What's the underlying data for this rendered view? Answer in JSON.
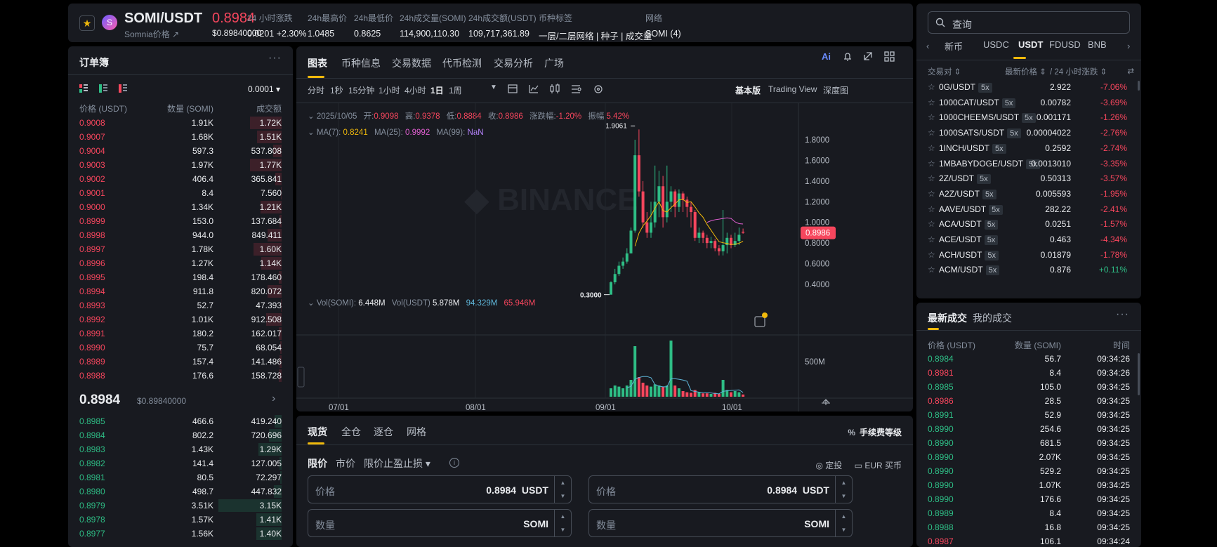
{
  "header": {
    "symbol": "SOMI/USDT",
    "subtitle": "Somnia价格 ↗",
    "last_price": "0.8984",
    "last_price_usd": "$0.89840000",
    "stats": [
      {
        "label": "24 小时涨跌",
        "value": "0.0201 +2.30%",
        "kind": "up"
      },
      {
        "label": "24h最高价",
        "value": "1.0485",
        "kind": "normal"
      },
      {
        "label": "24h最低价",
        "value": "0.8625",
        "kind": "normal"
      },
      {
        "label": "24h成交量(SOMI)",
        "value": "114,900,110.30",
        "kind": "normal"
      },
      {
        "label": "24h成交额(USDT)",
        "value": "109,717,361.89",
        "kind": "normal"
      },
      {
        "label": "币种标签",
        "value": "一层/二层网络 | 种子 | 成交量",
        "kind": "yellow"
      },
      {
        "label": "网络",
        "value": "SOMI (4)",
        "kind": "normal"
      }
    ]
  },
  "orderbook": {
    "title": "订单簿",
    "tick": "0.0001 ▾",
    "cols": [
      "价格 (USDT)",
      "数量 (SOMI)",
      "成交额"
    ],
    "asks": [
      [
        "0.9008",
        "1.91K",
        "1.72K",
        0.45
      ],
      [
        "0.9007",
        "1.68K",
        "1.51K",
        0.35
      ],
      [
        "0.9004",
        "597.3",
        "537.808",
        0.12
      ],
      [
        "0.9003",
        "1.97K",
        "1.77K",
        0.45
      ],
      [
        "0.9002",
        "406.4",
        "365.841",
        0.09
      ],
      [
        "0.9001",
        "8.4",
        "7.560",
        0.01
      ],
      [
        "0.9000",
        "1.34K",
        "1.21K",
        0.3
      ],
      [
        "0.8999",
        "153.0",
        "137.684",
        0.03
      ],
      [
        "0.8998",
        "944.0",
        "849.411",
        0.2
      ],
      [
        "0.8997",
        "1.78K",
        "1.60K",
        0.4
      ],
      [
        "0.8996",
        "1.27K",
        "1.14K",
        0.29
      ],
      [
        "0.8995",
        "198.4",
        "178.460",
        0.04
      ],
      [
        "0.8994",
        "911.8",
        "820.072",
        0.2
      ],
      [
        "0.8993",
        "52.7",
        "47.393",
        0.01
      ],
      [
        "0.8992",
        "1.01K",
        "912.508",
        0.22
      ],
      [
        "0.8991",
        "180.2",
        "162.017",
        0.04
      ],
      [
        "0.8990",
        "75.7",
        "68.054",
        0.02
      ],
      [
        "0.8989",
        "157.4",
        "141.486",
        0.03
      ],
      [
        "0.8988",
        "176.6",
        "158.728",
        0.04
      ]
    ],
    "mid_price": "0.8984",
    "mid_usd": "$0.89840000",
    "bids": [
      [
        "0.8985",
        "466.6",
        "419.240",
        0.1
      ],
      [
        "0.8984",
        "802.2",
        "720.696",
        0.18
      ],
      [
        "0.8983",
        "1.43K",
        "1.29K",
        0.33
      ],
      [
        "0.8982",
        "141.4",
        "127.005",
        0.03
      ],
      [
        "0.8981",
        "80.5",
        "72.297",
        0.02
      ],
      [
        "0.8980",
        "498.7",
        "447.832",
        0.11
      ],
      [
        "0.8979",
        "3.51K",
        "3.15K",
        0.9
      ],
      [
        "0.8978",
        "1.57K",
        "1.41K",
        0.36
      ],
      [
        "0.8977",
        "1.56K",
        "1.40K",
        0.36
      ]
    ]
  },
  "chart_panel": {
    "tabs": [
      "图表",
      "币种信息",
      "交易数据",
      "代币检测",
      "交易分析",
      "广场"
    ],
    "intervals": [
      "分时",
      "1秒",
      "15分钟",
      "1小时",
      "4小时",
      "1日",
      "1周"
    ],
    "active_interval": "1日",
    "views": [
      "基本版",
      "Trading View",
      "深度图"
    ],
    "ohlc_line": {
      "date": "2025/10/05",
      "open_l": "开:",
      "open": "0.9098",
      "high_l": "高:",
      "high": "0.9378",
      "low_l": "低:",
      "low": "0.8884",
      "close_l": "收:",
      "close": "0.8986",
      "chg_l": "涨跌幅:",
      "chg": "-1.20%",
      "amp_l": "振幅:",
      "amp": "5.42%"
    },
    "ma_line": {
      "ma7_l": "MA(7):",
      "ma7": "0.8241",
      "ma25_l": "MA(25):",
      "ma25": "0.9992",
      "ma99_l": "MA(99):",
      "ma99": "NaN"
    },
    "vol_line": {
      "vs_l": "Vol(SOMI):",
      "vs": "6.448M",
      "vu_l": "Vol(USDT)",
      "vu": "5.878M",
      "a": "94.329M",
      "b": "65.946M"
    },
    "watermark": "BINANCE",
    "price_tag": "0.8986",
    "high_label": "1.9061",
    "low_label": "0.3000"
  },
  "chart_data": {
    "type": "candlestick",
    "y_ticks": [
      "1.8000",
      "1.6000",
      "1.4000",
      "1.2000",
      "1.0000",
      "0.8000",
      "0.6000",
      "0.4000"
    ],
    "x_ticks": [
      "07/01",
      "08/01",
      "09/01",
      "10/01"
    ],
    "vol_tick": "500M",
    "candles": [
      [
        0.3,
        0.42,
        0.3,
        0.43
      ],
      [
        0.42,
        0.5,
        0.4,
        0.55
      ],
      [
        0.5,
        0.58,
        0.48,
        0.62
      ],
      [
        0.58,
        0.62,
        0.55,
        0.66
      ],
      [
        0.62,
        0.7,
        0.6,
        0.75
      ],
      [
        0.7,
        0.92,
        0.7,
        0.95
      ],
      [
        0.92,
        1.65,
        0.9,
        1.8
      ],
      [
        1.65,
        1.3,
        1.25,
        1.9
      ],
      [
        1.3,
        1.0,
        0.95,
        1.4
      ],
      [
        1.0,
        0.9,
        0.85,
        1.1
      ],
      [
        0.9,
        1.0,
        0.85,
        1.2
      ],
      [
        1.0,
        1.2,
        0.95,
        1.55
      ],
      [
        1.2,
        1.35,
        1.05,
        1.5
      ],
      [
        1.35,
        1.05,
        0.95,
        1.45
      ],
      [
        1.05,
        1.2,
        1.0,
        1.55
      ],
      [
        1.2,
        1.3,
        1.1,
        1.35
      ],
      [
        1.3,
        1.15,
        1.05,
        1.32
      ],
      [
        1.15,
        1.28,
        1.1,
        1.32
      ],
      [
        1.28,
        1.22,
        1.1,
        1.3
      ],
      [
        1.22,
        1.15,
        1.05,
        1.25
      ],
      [
        1.15,
        1.1,
        0.95,
        1.2
      ],
      [
        1.1,
        0.85,
        0.82,
        1.12
      ],
      [
        0.85,
        0.9,
        0.8,
        0.95
      ],
      [
        0.9,
        0.85,
        0.8,
        0.92
      ],
      [
        0.85,
        0.8,
        0.75,
        0.88
      ],
      [
        0.8,
        0.82,
        0.75,
        0.86
      ],
      [
        0.82,
        0.75,
        0.72,
        0.84
      ],
      [
        0.75,
        0.72,
        0.68,
        0.78
      ],
      [
        0.72,
        0.78,
        0.68,
        1.12
      ],
      [
        0.78,
        0.85,
        0.7,
        0.9
      ],
      [
        0.85,
        0.78,
        0.75,
        0.88
      ],
      [
        0.78,
        0.82,
        0.76,
        0.9
      ],
      [
        0.82,
        0.88,
        0.78,
        0.95
      ],
      [
        0.91,
        0.9,
        0.89,
        0.94
      ]
    ],
    "volumes": [
      0.15,
      0.2,
      0.18,
      0.15,
      0.2,
      0.3,
      0.9,
      0.35,
      0.25,
      0.2,
      0.18,
      0.22,
      0.2,
      0.18,
      0.2,
      1.0,
      0.2,
      0.15,
      0.1,
      0.08,
      0.07,
      0.12,
      0.08,
      0.06,
      0.06,
      0.05,
      0.07,
      0.05,
      0.3,
      0.12,
      0.08,
      0.1,
      0.08,
      0.04
    ]
  },
  "order": {
    "tabs": [
      "现货",
      "全仓",
      "逐仓",
      "网格"
    ],
    "fee_label": "手续费等级",
    "types": [
      "限价",
      "市价",
      "限价止盈止损 ▾"
    ],
    "extra": [
      "定投",
      "EUR 买币"
    ],
    "price_label": "价格",
    "price_val": "0.8984",
    "price_unit": "USDT",
    "qty_label": "数量",
    "qty_unit": "SOMI"
  },
  "market": {
    "search_ph": "查询",
    "tabs": [
      "新币",
      "USDC",
      "USDT",
      "FDUSD",
      "BNB"
    ],
    "active_tab": "USDT",
    "cols": [
      "交易对 ⇕",
      "最新价格 ⇕",
      "/ 24 小时涨跌 ⇕"
    ],
    "rows": [
      [
        "0G/USDT",
        "5x",
        "2.922",
        "-7.06%"
      ],
      [
        "1000CAT/USDT",
        "5x",
        "0.00782",
        "-3.69%"
      ],
      [
        "1000CHEEMS/USDT",
        "5x",
        "0.001171",
        "-1.26%"
      ],
      [
        "1000SATS/USDT",
        "5x",
        "0.00004022",
        "-2.76%"
      ],
      [
        "1INCH/USDT",
        "5x",
        "0.2592",
        "-2.74%"
      ],
      [
        "1MBABYDOGE/USDT",
        "5x",
        "0.0013010",
        "-3.35%"
      ],
      [
        "2Z/USDT",
        "5x",
        "0.50313",
        "-3.57%"
      ],
      [
        "A2Z/USDT",
        "5x",
        "0.005593",
        "-1.95%"
      ],
      [
        "AAVE/USDT",
        "5x",
        "282.22",
        "-2.41%"
      ],
      [
        "ACA/USDT",
        "5x",
        "0.0251",
        "-1.57%"
      ],
      [
        "ACE/USDT",
        "5x",
        "0.463",
        "-4.34%"
      ],
      [
        "ACH/USDT",
        "5x",
        "0.01879",
        "-1.78%"
      ],
      [
        "ACM/USDT",
        "5x",
        "0.876",
        "+0.11%"
      ]
    ]
  },
  "trades": {
    "tabs": [
      "最新成交",
      "我的成交"
    ],
    "cols": [
      "价格 (USDT)",
      "数量 (SOMI)",
      "时间"
    ],
    "rows": [
      [
        "0.8984",
        "56.7",
        "09:34:26",
        "up"
      ],
      [
        "0.8981",
        "8.4",
        "09:34:26",
        "down"
      ],
      [
        "0.8985",
        "105.0",
        "09:34:25",
        "up"
      ],
      [
        "0.8986",
        "28.5",
        "09:34:25",
        "down"
      ],
      [
        "0.8991",
        "52.9",
        "09:34:25",
        "up"
      ],
      [
        "0.8990",
        "254.6",
        "09:34:25",
        "up"
      ],
      [
        "0.8990",
        "681.5",
        "09:34:25",
        "up"
      ],
      [
        "0.8990",
        "2.07K",
        "09:34:25",
        "up"
      ],
      [
        "0.8990",
        "529.2",
        "09:34:25",
        "up"
      ],
      [
        "0.8990",
        "1.07K",
        "09:34:25",
        "up"
      ],
      [
        "0.8990",
        "176.6",
        "09:34:25",
        "up"
      ],
      [
        "0.8989",
        "8.4",
        "09:34:25",
        "up"
      ],
      [
        "0.8988",
        "16.8",
        "09:34:25",
        "up"
      ],
      [
        "0.8987",
        "106.1",
        "09:34:24",
        "down"
      ]
    ]
  },
  "colors": {
    "up": "#2ebd85",
    "down": "#f6465d",
    "accent": "#f0b90b",
    "bg": "#181a20"
  }
}
